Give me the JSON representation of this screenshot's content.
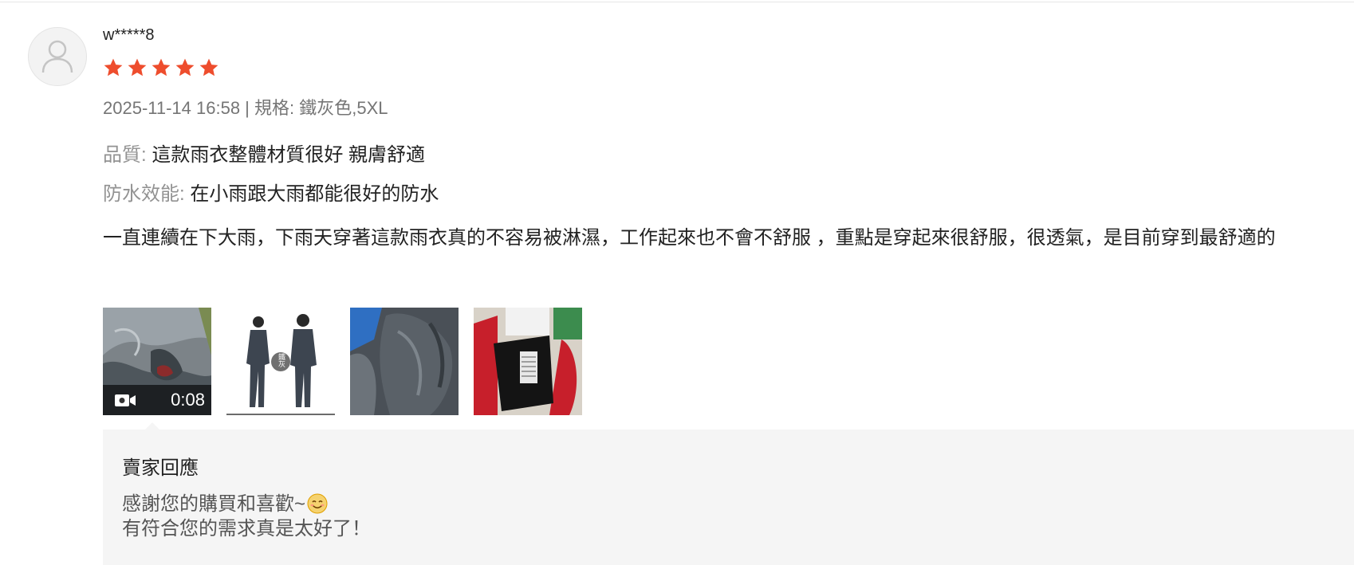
{
  "review": {
    "username": "w*****8",
    "rating": 5,
    "meta": "2025-11-14 16:58 | 規格: 鐵灰色,5XL",
    "attributes": [
      {
        "label": "品質:",
        "value": " 這款雨衣整體材質很好 親膚舒適"
      },
      {
        "label": "防水效能:",
        "value": " 在小雨跟大雨都能很好的防水"
      }
    ],
    "comment": "一直連續在下大雨，下雨天穿著這款雨衣真的不容易被淋濕，工作起來也不會不舒服 ，重點是穿起來很舒服，很透氣，是目前穿到最舒適的",
    "media": {
      "video_duration": "0:08",
      "video_icon": "video-camera-icon",
      "photo_badge_text": "鐵灰"
    }
  },
  "seller_reply": {
    "title": "賣家回應",
    "line1": "感謝您的購買和喜歡~",
    "emoji_icon": "smiling-face-icon",
    "line2": "有符合您的需求真是太好了！"
  },
  "colors": {
    "star": "#ee4d2d",
    "reply_bg": "#f5f5f5",
    "label_gray": "#929292",
    "meta_gray": "#757575"
  }
}
